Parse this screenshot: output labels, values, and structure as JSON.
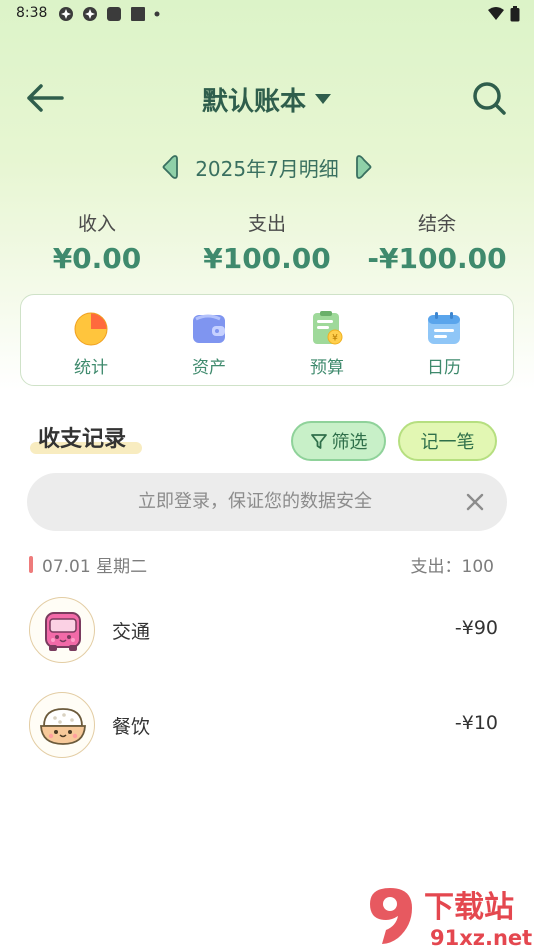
{
  "status_bar": {
    "time": "8:38"
  },
  "header": {
    "back_icon": "arrow-left-icon",
    "title": "默认账本",
    "title_dropdown_icon": "caret-down-icon",
    "search_icon": "search-icon"
  },
  "month_switcher": {
    "label": "2025年7月明细",
    "prev_icon": "chevron-left-icon",
    "next_icon": "chevron-right-icon"
  },
  "summary": {
    "income_label": "收入",
    "income_value": "¥0.00",
    "expense_label": "支出",
    "expense_value": "¥100.00",
    "balance_label": "结余",
    "balance_value": "-¥100.00"
  },
  "quick_menu": [
    {
      "label": "统计",
      "icon": "pie-chart-icon"
    },
    {
      "label": "资产",
      "icon": "wallet-icon"
    },
    {
      "label": "预算",
      "icon": "budget-icon"
    },
    {
      "label": "日历",
      "icon": "calendar-icon"
    }
  ],
  "records_section": {
    "title": "收支记录",
    "filter_label": "筛选",
    "add_label": "记一笔"
  },
  "login_banner": {
    "text": "立即登录，保证您的数据安全"
  },
  "day_group": {
    "date": "07.01 星期二",
    "total": "支出：100"
  },
  "records": [
    {
      "category": "交通",
      "amount": "-¥90",
      "icon": "bus-icon"
    },
    {
      "category": "餐饮",
      "amount": "-¥10",
      "icon": "rice-bowl-icon"
    }
  ],
  "watermark": {
    "text_top": "下载站",
    "text_bottom": "91xz.net"
  },
  "colors": {
    "accent_green": "#3f8a6d",
    "title_green": "#2f5e4c",
    "filter_bg": "#c8f0c8",
    "add_bg": "#e2f7b3",
    "day_marker": "#ee7b7b"
  }
}
